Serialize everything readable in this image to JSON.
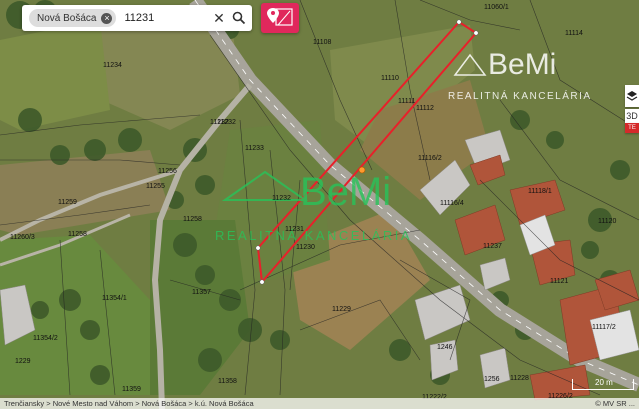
{
  "search": {
    "chip_label": "Nová Bošáca",
    "query": "11231",
    "clear_icon": "close-icon",
    "search_icon": "search-icon"
  },
  "toolbar": {
    "cadastre_icon": "cadastre-pin-icon",
    "accent_color": "#e0285c",
    "layers_icon": "layers-icon",
    "btn_3d": "3D",
    "btn_te": "TE"
  },
  "watermark": {
    "brand": "BeMi",
    "subtitle": "REALITNÁ KANCELÁRIA"
  },
  "parcels": [
    "11060/1",
    "11114",
    "11108",
    "11234",
    "11110",
    "11111",
    "11112",
    "11232",
    "11233",
    "11116/2",
    "11118/1",
    "11120",
    "11255",
    "11256",
    "11259",
    "11260/3",
    "11258",
    "11232",
    "11231",
    "11230",
    "11229",
    "11354/1",
    "11357",
    "11354/2",
    "11358",
    "11359",
    "11117/2",
    "11116/4",
    "11237",
    "11121",
    "1229",
    "11228",
    "11226/2",
    "11222/2",
    "1256",
    "1246",
    "11232",
    "11258"
  ],
  "scale": {
    "label": "20 m"
  },
  "attribution": {
    "breadcrumb": "Trenčiansky > Nové Mesto nad Váhom > Nová Bošáca > k.ú. Nová Bošáca",
    "source": "© MV SR ..."
  },
  "highlight_color": "#e8202a"
}
